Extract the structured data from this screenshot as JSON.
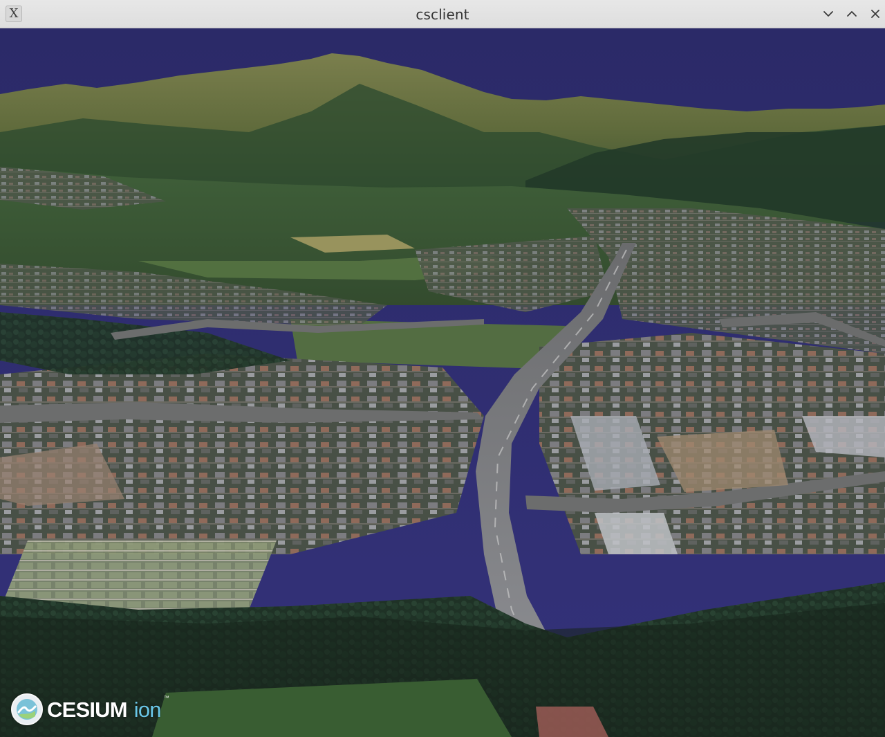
{
  "window": {
    "title": "csclient",
    "app_icon_glyph": "X",
    "controls": {
      "minimize_icon": "chevron-down-icon",
      "maximize_icon": "chevron-up-icon",
      "close_icon": "close-icon"
    }
  },
  "viewer": {
    "scene": "3D terrain with satellite imagery: mountain ridge under a dark blue sky, valley town with streets and buildings, forest in foreground",
    "sky_color": "#2d2b6c"
  },
  "credits": {
    "logo_word": "CESIUM",
    "logo_suffix": "ion",
    "logo_tm": "™"
  }
}
